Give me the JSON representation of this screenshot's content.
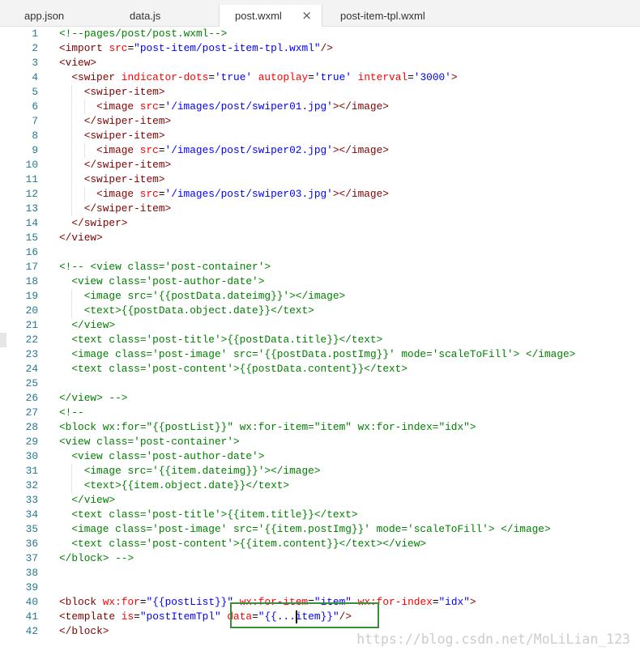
{
  "tabs": [
    {
      "label": "app.json",
      "active": false
    },
    {
      "label": "data.js",
      "active": false
    },
    {
      "label": "post.wxml",
      "active": true,
      "close_icon": "close-icon",
      "close_glyph": "×"
    },
    {
      "label": "post-item-tpl.wxml",
      "active": false
    }
  ],
  "editor": {
    "lines": [
      {
        "n": 1,
        "indent": 0,
        "tokens": [
          {
            "t": "comment",
            "v": "<!--pages/post/post.wxml-->"
          }
        ]
      },
      {
        "n": 2,
        "indent": 0,
        "tokens": [
          {
            "t": "tag",
            "v": "<import"
          },
          {
            "t": "attribute",
            "v": " src"
          },
          {
            "t": "operator",
            "v": "="
          },
          {
            "t": "string",
            "v": "\"post-item/post-item-tpl.wxml\""
          },
          {
            "t": "tag",
            "v": "/>"
          }
        ]
      },
      {
        "n": 3,
        "indent": 0,
        "tokens": [
          {
            "t": "tag",
            "v": "<view>"
          }
        ]
      },
      {
        "n": 4,
        "indent": 2,
        "tokens": [
          {
            "t": "tag",
            "v": "<swiper"
          },
          {
            "t": "attribute",
            "v": " indicator-dots"
          },
          {
            "t": "operator",
            "v": "="
          },
          {
            "t": "string",
            "v": "'true'"
          },
          {
            "t": "attribute",
            "v": " autoplay"
          },
          {
            "t": "operator",
            "v": "="
          },
          {
            "t": "string",
            "v": "'true'"
          },
          {
            "t": "attribute",
            "v": " interval"
          },
          {
            "t": "operator",
            "v": "="
          },
          {
            "t": "string",
            "v": "'3000'"
          },
          {
            "t": "tag",
            "v": ">"
          }
        ]
      },
      {
        "n": 5,
        "indent": 4,
        "tokens": [
          {
            "t": "tag",
            "v": "<swiper-item>"
          }
        ]
      },
      {
        "n": 6,
        "indent": 6,
        "tokens": [
          {
            "t": "tag",
            "v": "<image"
          },
          {
            "t": "attribute",
            "v": " src"
          },
          {
            "t": "operator",
            "v": "="
          },
          {
            "t": "string",
            "v": "'/images/post/swiper01.jpg'"
          },
          {
            "t": "tag",
            "v": "></image>"
          }
        ]
      },
      {
        "n": 7,
        "indent": 4,
        "tokens": [
          {
            "t": "tag",
            "v": "</swiper-item>"
          }
        ]
      },
      {
        "n": 8,
        "indent": 4,
        "tokens": [
          {
            "t": "tag",
            "v": "<swiper-item>"
          }
        ]
      },
      {
        "n": 9,
        "indent": 6,
        "tokens": [
          {
            "t": "tag",
            "v": "<image"
          },
          {
            "t": "attribute",
            "v": " src"
          },
          {
            "t": "operator",
            "v": "="
          },
          {
            "t": "string",
            "v": "'/images/post/swiper02.jpg'"
          },
          {
            "t": "tag",
            "v": "></image>"
          }
        ]
      },
      {
        "n": 10,
        "indent": 4,
        "tokens": [
          {
            "t": "tag",
            "v": "</swiper-item>"
          }
        ]
      },
      {
        "n": 11,
        "indent": 4,
        "tokens": [
          {
            "t": "tag",
            "v": "<swiper-item>"
          }
        ]
      },
      {
        "n": 12,
        "indent": 6,
        "tokens": [
          {
            "t": "tag",
            "v": "<image"
          },
          {
            "t": "attribute",
            "v": " src"
          },
          {
            "t": "operator",
            "v": "="
          },
          {
            "t": "string",
            "v": "'/images/post/swiper03.jpg'"
          },
          {
            "t": "tag",
            "v": "></image>"
          }
        ]
      },
      {
        "n": 13,
        "indent": 4,
        "tokens": [
          {
            "t": "tag",
            "v": "</swiper-item>"
          }
        ]
      },
      {
        "n": 14,
        "indent": 2,
        "tokens": [
          {
            "t": "tag",
            "v": "</swiper>"
          }
        ]
      },
      {
        "n": 15,
        "indent": 0,
        "tokens": [
          {
            "t": "tag",
            "v": "</view>"
          }
        ]
      },
      {
        "n": 16,
        "indent": 0,
        "tokens": []
      },
      {
        "n": 17,
        "indent": 0,
        "tokens": [
          {
            "t": "comment",
            "v": "<!-- <view class='post-container'>"
          }
        ]
      },
      {
        "n": 18,
        "indent": 2,
        "tokens": [
          {
            "t": "comment",
            "v": "<view class='post-author-date'>"
          }
        ]
      },
      {
        "n": 19,
        "indent": 4,
        "tokens": [
          {
            "t": "comment",
            "v": "<image src='{{postData.dateimg}}'></image>"
          }
        ]
      },
      {
        "n": 20,
        "indent": 4,
        "tokens": [
          {
            "t": "comment",
            "v": "<text>{{postData.object.date}}</text>"
          }
        ]
      },
      {
        "n": 21,
        "indent": 2,
        "tokens": [
          {
            "t": "comment",
            "v": "</view>"
          }
        ]
      },
      {
        "n": 22,
        "indent": 2,
        "tokens": [
          {
            "t": "comment",
            "v": "<text class='post-title'>{{postData.title}}</text>"
          }
        ]
      },
      {
        "n": 23,
        "indent": 2,
        "tokens": [
          {
            "t": "comment",
            "v": "<image class='post-image' src='{{postData.postImg}}' mode='scaleToFill'> </image>"
          }
        ]
      },
      {
        "n": 24,
        "indent": 2,
        "tokens": [
          {
            "t": "comment",
            "v": "<text class='post-content'>{{postData.content}}</text>"
          }
        ]
      },
      {
        "n": 25,
        "indent": 0,
        "tokens": []
      },
      {
        "n": 26,
        "indent": 0,
        "tokens": [
          {
            "t": "comment",
            "v": "</view> -->"
          }
        ]
      },
      {
        "n": 27,
        "indent": 0,
        "tokens": [
          {
            "t": "comment",
            "v": "<!--"
          }
        ]
      },
      {
        "n": 28,
        "indent": 0,
        "tokens": [
          {
            "t": "comment",
            "v": "<block wx:for=\"{{postList}}\" wx:for-item=\"item\" wx:for-index=\"idx\">"
          }
        ]
      },
      {
        "n": 29,
        "indent": 0,
        "tokens": [
          {
            "t": "comment",
            "v": "<view class='post-container'>"
          }
        ]
      },
      {
        "n": 30,
        "indent": 2,
        "tokens": [
          {
            "t": "comment",
            "v": "<view class='post-author-date'>"
          }
        ]
      },
      {
        "n": 31,
        "indent": 4,
        "tokens": [
          {
            "t": "comment",
            "v": "<image src='{{item.dateimg}}'></image>"
          }
        ]
      },
      {
        "n": 32,
        "indent": 4,
        "tokens": [
          {
            "t": "comment",
            "v": "<text>{{item.object.date}}</text>"
          }
        ]
      },
      {
        "n": 33,
        "indent": 2,
        "tokens": [
          {
            "t": "comment",
            "v": "</view>"
          }
        ]
      },
      {
        "n": 34,
        "indent": 2,
        "tokens": [
          {
            "t": "comment",
            "v": "<text class='post-title'>{{item.title}}</text>"
          }
        ]
      },
      {
        "n": 35,
        "indent": 2,
        "tokens": [
          {
            "t": "comment",
            "v": "<image class='post-image' src='{{item.postImg}}' mode='scaleToFill'> </image>"
          }
        ]
      },
      {
        "n": 36,
        "indent": 2,
        "tokens": [
          {
            "t": "comment",
            "v": "<text class='post-content'>{{item.content}}</text></view>"
          }
        ]
      },
      {
        "n": 37,
        "indent": 0,
        "tokens": [
          {
            "t": "comment",
            "v": "</block> -->"
          }
        ]
      },
      {
        "n": 38,
        "indent": 0,
        "tokens": []
      },
      {
        "n": 39,
        "indent": 0,
        "tokens": []
      },
      {
        "n": 40,
        "indent": 0,
        "tokens": [
          {
            "t": "tag",
            "v": "<block"
          },
          {
            "t": "attribute",
            "v": " wx:for"
          },
          {
            "t": "operator",
            "v": "="
          },
          {
            "t": "string",
            "v": "\"{{postList}}\""
          },
          {
            "t": "attribute",
            "v": " wx:for-item"
          },
          {
            "t": "operator",
            "v": "="
          },
          {
            "t": "string",
            "v": "\"item\""
          },
          {
            "t": "attribute",
            "v": " wx:for-index"
          },
          {
            "t": "operator",
            "v": "="
          },
          {
            "t": "string",
            "v": "\"idx\""
          },
          {
            "t": "tag",
            "v": ">"
          }
        ]
      },
      {
        "n": 41,
        "indent": 0,
        "tokens": [
          {
            "t": "tag",
            "v": "<template"
          },
          {
            "t": "attribute",
            "v": " is"
          },
          {
            "t": "operator",
            "v": "="
          },
          {
            "t": "string",
            "v": "\"postItemTpl\""
          },
          {
            "t": "attribute",
            "v": " data"
          },
          {
            "t": "operator",
            "v": "="
          },
          {
            "t": "string",
            "v": "\"{{...item}}\""
          },
          {
            "t": "tag",
            "v": "/>"
          }
        ]
      },
      {
        "n": 42,
        "indent": 0,
        "tokens": [
          {
            "t": "tag",
            "v": "</block>"
          }
        ]
      }
    ]
  },
  "watermark": "https://blog.csdn.net/MoLiLian_123",
  "colors": {
    "syntax": {
      "comment": "#008000",
      "tag": "#800000",
      "attribute": "#ff0000",
      "operator": "#000000",
      "string": "#0000ff"
    },
    "line_number": "#237893",
    "indent_guide": "#e3e3e3",
    "annotation_box": "#3c8d3c",
    "watermark": "#cccccc"
  }
}
